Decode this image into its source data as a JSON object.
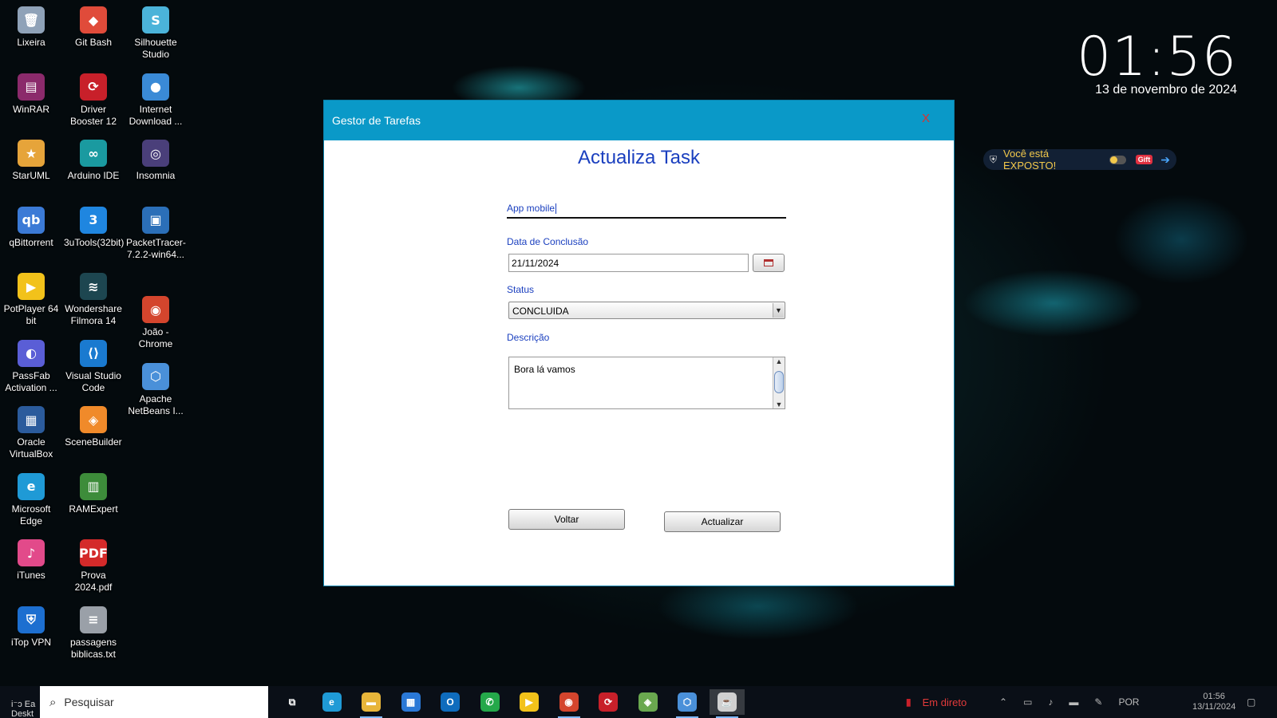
{
  "desktop": {
    "icons": [
      {
        "label": "Lixeira",
        "glyph": "🗑",
        "color": "#8fa2b8"
      },
      {
        "label": "Git Bash",
        "glyph": "◆",
        "color": "#e04b3a"
      },
      {
        "label": "Silhouette Studio",
        "glyph": "S",
        "color": "#4bb3d9"
      },
      {
        "label": "WinRAR",
        "glyph": "▤",
        "color": "#8b2a6b"
      },
      {
        "label": "Driver Booster 12",
        "glyph": "⟳",
        "color": "#c8202a"
      },
      {
        "label": "Internet Download ...",
        "glyph": "●",
        "color": "#3a8ad6"
      },
      {
        "label": "StarUML",
        "glyph": "★",
        "color": "#e6a43a"
      },
      {
        "label": "Arduino IDE",
        "glyph": "∞",
        "color": "#1a9aa0"
      },
      {
        "label": "Insomnia",
        "glyph": "◎",
        "color": "#4a3f7a"
      },
      {
        "label": "qBittorrent",
        "glyph": "qb",
        "color": "#3b7ad6"
      },
      {
        "label": "3uTools(32bit)",
        "glyph": "3",
        "color": "#1f86e0"
      },
      {
        "label": "PacketTracer-7.2.2-win64...",
        "glyph": "▣",
        "color": "#2b6fb8"
      },
      {
        "label": "PotPlayer 64 bit",
        "glyph": "▶",
        "color": "#f2c21a"
      },
      {
        "label": "Wondershare Filmora 14",
        "glyph": "≋",
        "color": "#1d4650"
      },
      {
        "label": "João - Chrome",
        "glyph": "◉",
        "color": "#d4452d"
      },
      {
        "label": "PassFab Activation ...",
        "glyph": "◐",
        "color": "#5a5ed6"
      },
      {
        "label": "Visual Studio Code",
        "glyph": "⟨⟩",
        "color": "#1a7ad0"
      },
      {
        "label": "Apache NetBeans I...",
        "glyph": "⬡",
        "color": "#4a90d9"
      },
      {
        "label": "Oracle VirtualBox",
        "glyph": "▦",
        "color": "#2b5b9c"
      },
      {
        "label": "SceneBuilder",
        "glyph": "◈",
        "color": "#f08a2a"
      },
      {
        "label": "Microsoft Edge",
        "glyph": "e",
        "color": "#1f9ad6"
      },
      {
        "label": "RAMExpert",
        "glyph": "▥",
        "color": "#3d8c3a"
      },
      {
        "label": "iTunes",
        "glyph": "♪",
        "color": "#e24a8a"
      },
      {
        "label": "Prova 2024.pdf",
        "glyph": "PDF",
        "color": "#d42a2a"
      },
      {
        "label": "iTop VPN",
        "glyph": "⛨",
        "color": "#1d6fd0"
      },
      {
        "label": "passagens biblicas.txt",
        "glyph": "≡",
        "color": "#9aa0a8"
      }
    ]
  },
  "clock": {
    "time": "01:56",
    "date": "13 de novembro de 2024"
  },
  "vpn_widget": {
    "text": "Você está EXPOSTO!",
    "gift": "Gift"
  },
  "window": {
    "title": "Gestor de Tarefas",
    "close": "X",
    "heading": "Actualiza Task",
    "name_value": "App mobile",
    "date_label": "Data de Conclusão",
    "date_value": "21/11/2024",
    "status_label": "Status",
    "status_value": "CONCLUIDA",
    "description_label": "Descrição",
    "description_value": "Bora lá vamos",
    "back_button": "Voltar",
    "update_button": "Actualizar"
  },
  "taskbar": {
    "start_partial": "i⁻ɔ Ea Deskt",
    "search_placeholder": "Pesquisar",
    "live_text": "Em direto",
    "lang": "POR",
    "tray_time": "01:56",
    "tray_date": "13/11/2024",
    "apps": [
      {
        "name": "task-view",
        "glyph": "⧉",
        "color": "transparent"
      },
      {
        "name": "edge",
        "glyph": "e",
        "color": "#1f9ad6"
      },
      {
        "name": "file-explorer",
        "glyph": "▬",
        "color": "#e8b53a"
      },
      {
        "name": "store",
        "glyph": "▦",
        "color": "#2a78d6"
      },
      {
        "name": "outlook",
        "glyph": "O",
        "color": "#0f6cbd"
      },
      {
        "name": "whatsapp",
        "glyph": "✆",
        "color": "#25a84a"
      },
      {
        "name": "potplayer",
        "glyph": "▶",
        "color": "#f2c21a"
      },
      {
        "name": "chrome",
        "glyph": "◉",
        "color": "#d4452d"
      },
      {
        "name": "driver-booster",
        "glyph": "⟳",
        "color": "#c8202a"
      },
      {
        "name": "scenebuilder",
        "glyph": "◈",
        "color": "#6aa84f"
      },
      {
        "name": "virtualbox",
        "glyph": "⬡",
        "color": "#4a90d9"
      },
      {
        "name": "java",
        "glyph": "☕",
        "color": "#d0d0d0"
      }
    ]
  }
}
